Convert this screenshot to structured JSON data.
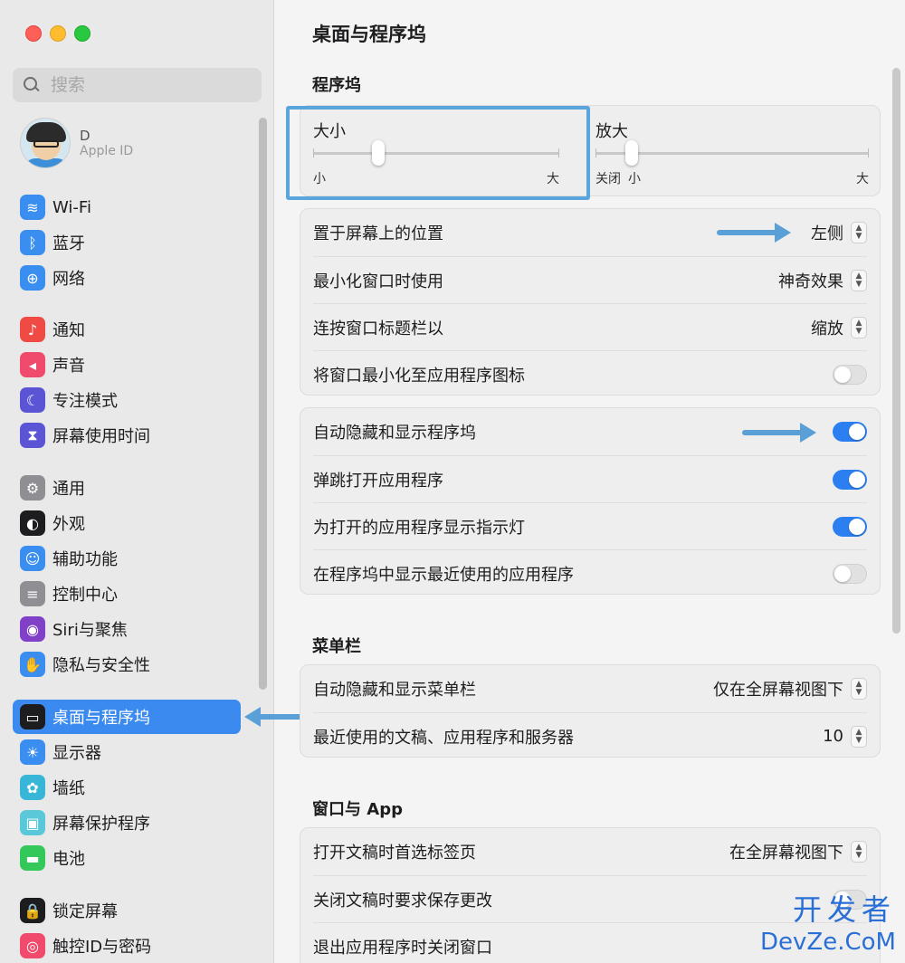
{
  "sidebar": {
    "search_placeholder": "搜索",
    "profile": {
      "name": "D",
      "sub": "Apple ID"
    },
    "items": [
      {
        "label": "Wi-Fi",
        "icon": "wifi-icon",
        "color": "#3a8ef0",
        "glyph": "≋"
      },
      {
        "label": "蓝牙",
        "icon": "bluetooth-icon",
        "color": "#3a8ef0",
        "glyph": "ᛒ"
      },
      {
        "label": "网络",
        "icon": "globe-icon",
        "color": "#3a8ef0",
        "glyph": "⊕"
      },
      {
        "label": "通知",
        "icon": "bell-icon",
        "color": "#f04a44",
        "glyph": "♪"
      },
      {
        "label": "声音",
        "icon": "speaker-icon",
        "color": "#f04a6c",
        "glyph": "◂"
      },
      {
        "label": "专注模式",
        "icon": "moon-icon",
        "color": "#5b55d6",
        "glyph": "☾"
      },
      {
        "label": "屏幕使用时间",
        "icon": "hourglass-icon",
        "color": "#5b55d6",
        "glyph": "⧗"
      },
      {
        "label": "通用",
        "icon": "gear-icon",
        "color": "#8e8e93",
        "glyph": "⚙"
      },
      {
        "label": "外观",
        "icon": "appearance-icon",
        "color": "#1d1d1f",
        "glyph": "◐"
      },
      {
        "label": "辅助功能",
        "icon": "accessibility-icon",
        "color": "#3a8ef0",
        "glyph": "☺"
      },
      {
        "label": "控制中心",
        "icon": "control-center-icon",
        "color": "#8e8e93",
        "glyph": "≡"
      },
      {
        "label": "Siri与聚焦",
        "icon": "siri-icon",
        "color": "#8040c8",
        "glyph": "◉"
      },
      {
        "label": "隐私与安全性",
        "icon": "hand-icon",
        "color": "#3a8ef0",
        "glyph": "✋"
      },
      {
        "label": "桌面与程序坞",
        "icon": "dock-icon",
        "color": "#1d1d1f",
        "glyph": "▭"
      },
      {
        "label": "显示器",
        "icon": "sun-icon",
        "color": "#3a8ef0",
        "glyph": "☀"
      },
      {
        "label": "墙纸",
        "icon": "flower-icon",
        "color": "#38b6d8",
        "glyph": "✿"
      },
      {
        "label": "屏幕保护程序",
        "icon": "screensaver-icon",
        "color": "#5ac8d8",
        "glyph": "▣"
      },
      {
        "label": "电池",
        "icon": "battery-icon",
        "color": "#34c759",
        "glyph": "▬"
      },
      {
        "label": "锁定屏幕",
        "icon": "lock-icon",
        "color": "#1d1d1f",
        "glyph": "🔒"
      },
      {
        "label": "触控ID与密码",
        "icon": "fingerprint-icon",
        "color": "#f04a6c",
        "glyph": "◎"
      }
    ]
  },
  "main": {
    "title": "桌面与程序坞",
    "dock_section": "程序坞",
    "size_slider": {
      "label": "大小",
      "min_label": "小",
      "max_label": "大",
      "value": 0.2
    },
    "magnify_slider": {
      "label": "放大",
      "off_label": "关闭",
      "min_label": "小",
      "max_label": "大",
      "value": 0.0
    },
    "position_rows": [
      {
        "label": "置于屏幕上的位置",
        "value": "左侧"
      },
      {
        "label": "最小化窗口时使用",
        "value": "神奇效果"
      },
      {
        "label": "连按窗口标题栏以",
        "value": "缩放"
      },
      {
        "label": "将窗口最小化至应用程序图标",
        "toggle": false
      }
    ],
    "dock_toggles": [
      {
        "label": "自动隐藏和显示程序坞",
        "toggle": true
      },
      {
        "label": "弹跳打开应用程序",
        "toggle": true
      },
      {
        "label": "为打开的应用程序显示指示灯",
        "toggle": true
      },
      {
        "label": "在程序坞中显示最近使用的应用程序",
        "toggle": false
      }
    ],
    "menubar_section": "菜单栏",
    "menubar_rows": [
      {
        "label": "自动隐藏和显示菜单栏",
        "value": "仅在全屏幕视图下"
      },
      {
        "label": "最近使用的文稿、应用程序和服务器",
        "value": "10"
      }
    ],
    "windows_section": "窗口与 App",
    "windows_rows": [
      {
        "label": "打开文稿时首选标签页",
        "value": "在全屏幕视图下"
      },
      {
        "label": "关闭文稿时要求保存更改",
        "toggle": false
      },
      {
        "label": "退出应用程序时关闭窗口"
      }
    ]
  },
  "watermark": {
    "top": "开发者",
    "bottom": "DevZe.CoM"
  },
  "colors": {
    "accent": "#3b8af0",
    "toggle_on": "#2b7ff0",
    "annotation": "#5aa0d6"
  }
}
